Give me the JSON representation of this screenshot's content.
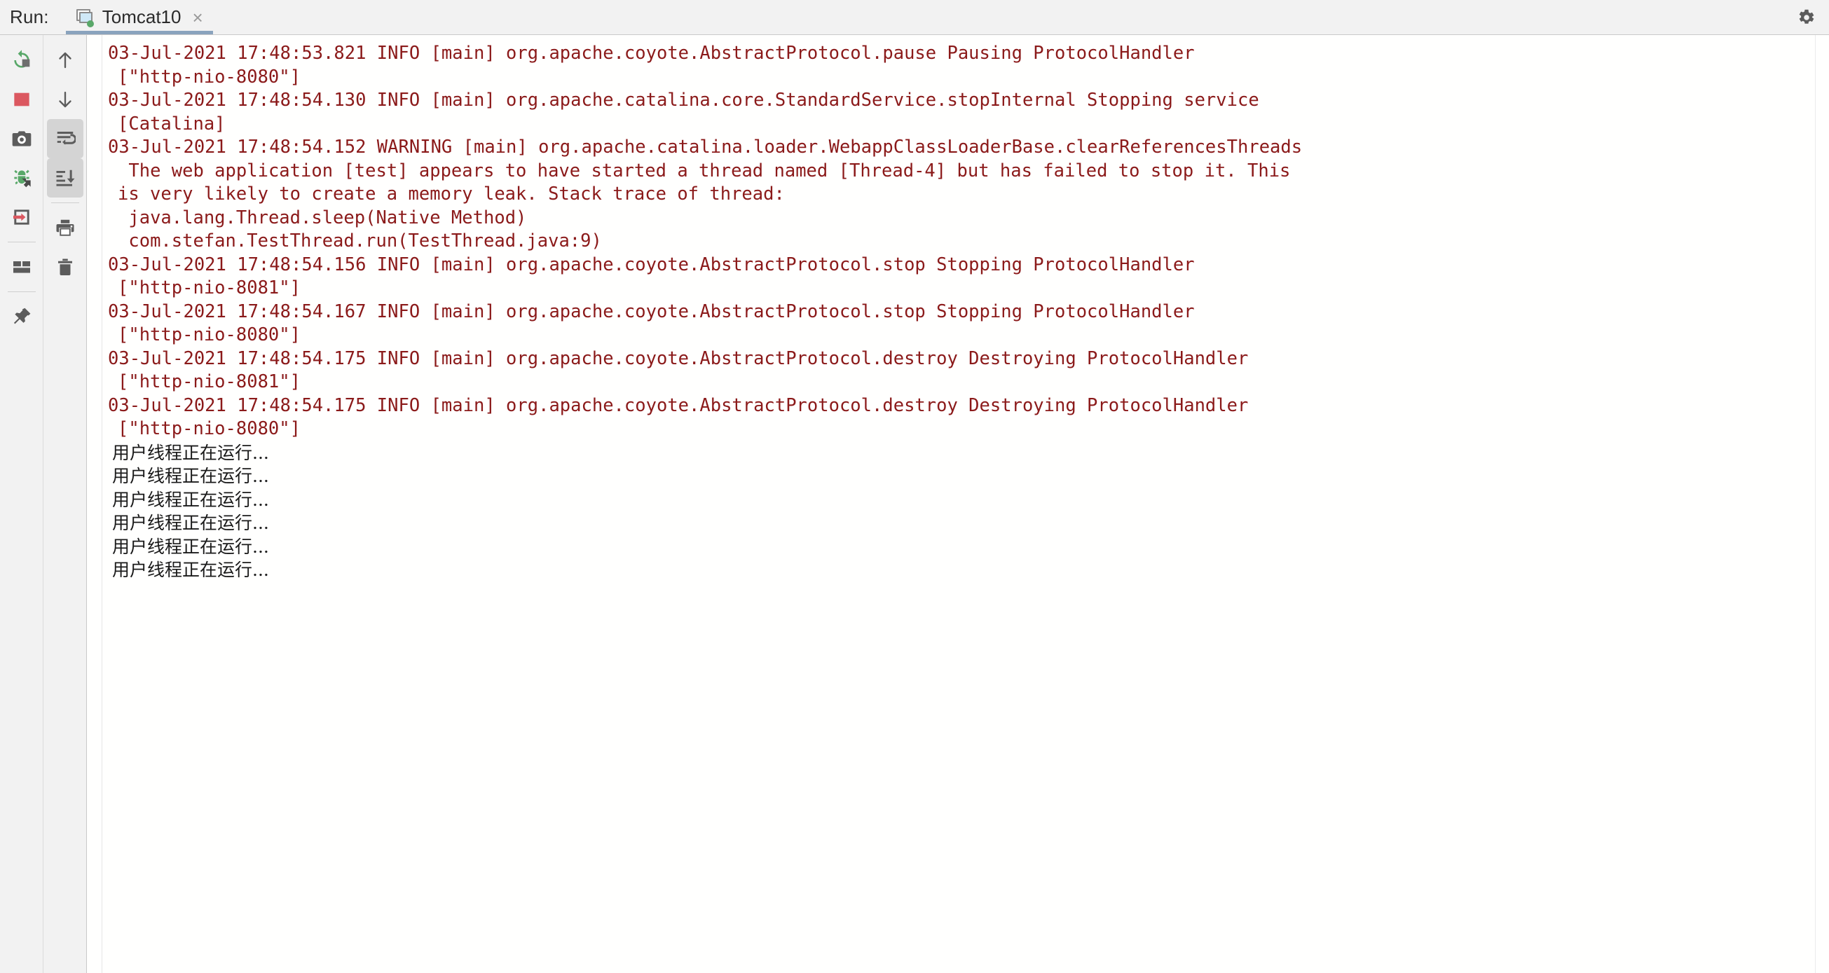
{
  "window": {
    "run_label": "Run:",
    "settings_icon": "gear-icon"
  },
  "tabs": [
    {
      "label": "Tomcat10",
      "icon": "tomcat-service-icon",
      "status_dot_color": "#59a869",
      "close_label": "×",
      "selected": true
    }
  ],
  "left_toolbar": {
    "items": [
      {
        "name": "rerun-button",
        "icon": "rerun-icon",
        "tooltip": "Rerun",
        "active": false
      },
      {
        "name": "stop-button",
        "icon": "stop-square-icon",
        "tooltip": "Stop",
        "active": false
      },
      {
        "name": "screenshot-button",
        "icon": "camera-icon",
        "tooltip": "Capture Screenshot",
        "active": false
      },
      {
        "name": "debug-button",
        "icon": "debug-bug-icon",
        "tooltip": "Debug",
        "active": false
      },
      {
        "name": "attach-button",
        "icon": "arrow-into-box-icon",
        "tooltip": "Attach",
        "active": false
      },
      {
        "name": "layout-button",
        "icon": "layout-grid-icon",
        "tooltip": "Layout",
        "active": false
      },
      {
        "name": "pin-button",
        "icon": "pin-icon",
        "tooltip": "Pin Tab",
        "active": false
      }
    ]
  },
  "console_toolbar": {
    "items": [
      {
        "name": "up-button",
        "icon": "arrow-up-icon",
        "tooltip": "Up the Stack Trace",
        "active": false
      },
      {
        "name": "down-button",
        "icon": "arrow-down-icon",
        "tooltip": "Down the Stack Trace",
        "active": false
      },
      {
        "name": "soft-wrap-button",
        "icon": "soft-wrap-icon",
        "tooltip": "Use Soft Wraps",
        "active": true
      },
      {
        "name": "scroll-to-end-button",
        "icon": "scroll-to-end-icon",
        "tooltip": "Scroll to the End",
        "active": true
      },
      {
        "name": "print-button",
        "icon": "printer-icon",
        "tooltip": "Print",
        "active": false
      },
      {
        "name": "clear-button",
        "icon": "trash-icon",
        "tooltip": "Clear All",
        "active": false
      }
    ]
  },
  "console": {
    "text_color": "#8b1a1a",
    "plain_color": "#1a1a1a",
    "background": "#fffffe",
    "lines": [
      {
        "kind": "log",
        "cont": false,
        "text": "03-Jul-2021 17:48:53.821 INFO [main] org.apache.coyote.AbstractProtocol.pause Pausing ProtocolHandler"
      },
      {
        "kind": "log",
        "cont": true,
        "text": "[\"http-nio-8080\"]"
      },
      {
        "kind": "log",
        "cont": false,
        "text": "03-Jul-2021 17:48:54.130 INFO [main] org.apache.catalina.core.StandardService.stopInternal Stopping service"
      },
      {
        "kind": "log",
        "cont": true,
        "text": "[Catalina]"
      },
      {
        "kind": "log",
        "cont": false,
        "text": "03-Jul-2021 17:48:54.152 WARNING [main] org.apache.catalina.loader.WebappClassLoaderBase.clearReferencesThreads"
      },
      {
        "kind": "log",
        "cont": true,
        "text": " The web application [test] appears to have started a thread named [Thread-4] but has failed to stop it. This"
      },
      {
        "kind": "log",
        "cont": true,
        "text": "is very likely to create a memory leak. Stack trace of thread:"
      },
      {
        "kind": "log",
        "cont": true,
        "text": " java.lang.Thread.sleep(Native Method)"
      },
      {
        "kind": "log",
        "cont": true,
        "text": " com.stefan.TestThread.run(TestThread.java:9)"
      },
      {
        "kind": "log",
        "cont": false,
        "text": "03-Jul-2021 17:48:54.156 INFO [main] org.apache.coyote.AbstractProtocol.stop Stopping ProtocolHandler"
      },
      {
        "kind": "log",
        "cont": true,
        "text": "[\"http-nio-8081\"]"
      },
      {
        "kind": "log",
        "cont": false,
        "text": "03-Jul-2021 17:48:54.167 INFO [main] org.apache.coyote.AbstractProtocol.stop Stopping ProtocolHandler"
      },
      {
        "kind": "log",
        "cont": true,
        "text": "[\"http-nio-8080\"]"
      },
      {
        "kind": "log",
        "cont": false,
        "text": "03-Jul-2021 17:48:54.175 INFO [main] org.apache.coyote.AbstractProtocol.destroy Destroying ProtocolHandler"
      },
      {
        "kind": "log",
        "cont": true,
        "text": "[\"http-nio-8081\"]"
      },
      {
        "kind": "log",
        "cont": false,
        "text": "03-Jul-2021 17:48:54.175 INFO [main] org.apache.coyote.AbstractProtocol.destroy Destroying ProtocolHandler"
      },
      {
        "kind": "log",
        "cont": true,
        "text": "[\"http-nio-8080\"]"
      },
      {
        "kind": "plain",
        "cont": false,
        "text": "用户线程正在运行..."
      },
      {
        "kind": "plain",
        "cont": false,
        "text": "用户线程正在运行..."
      },
      {
        "kind": "plain",
        "cont": false,
        "text": "用户线程正在运行..."
      },
      {
        "kind": "plain",
        "cont": false,
        "text": "用户线程正在运行..."
      },
      {
        "kind": "plain",
        "cont": false,
        "text": "用户线程正在运行..."
      },
      {
        "kind": "plain",
        "cont": false,
        "text": "用户线程正在运行..."
      }
    ]
  }
}
